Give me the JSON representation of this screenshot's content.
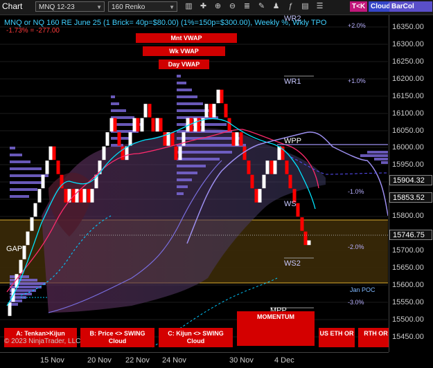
{
  "toolbar": {
    "title": "Chart",
    "instrument": "MNQ 12-23",
    "period": "160 Renko",
    "buttons": {
      "tk": "T<K",
      "cloud": "Cloud",
      "barcol": "BarCol"
    },
    "icons": [
      "bars-icon",
      "crosshair-icon",
      "zoom-in-icon",
      "zoom-out-icon",
      "properties-icon",
      "drawing-tools-icon",
      "strategies-icon",
      "indicators-icon",
      "templates-icon",
      "chart-trader-icon"
    ]
  },
  "header": {
    "line1": "MNQ or NQ 160 RE June 25 (1 Brick= 40p=$80.00) (1%=150p=$300.00), Weekly %, Wkly TPO",
    "line2": "-1.73% = -277.00"
  },
  "vwap_buttons": {
    "month": "Mnt VWAP",
    "week": "Wk VWAP",
    "day": "Day VWAP"
  },
  "price_axis": {
    "labels": [
      "16350.00",
      "16300.00",
      "16250.00",
      "16200.00",
      "16150.00",
      "16100.00",
      "16050.00",
      "16000.00",
      "15950.00",
      "15800.00",
      "15700.00",
      "15650.00",
      "15600.00",
      "15550.00",
      "15500.00",
      "15450.00"
    ],
    "boxes": [
      "15904.32",
      "15853.52",
      "15746.75"
    ]
  },
  "pivots": {
    "wr2": "WR2",
    "wr1": "WR1",
    "wpp": "WPP",
    "ws1": "WS",
    "ws2": "WS2",
    "mpp": "MPP",
    "gap": "GAP",
    "jan_poc": "Jan POC"
  },
  "percents": {
    "p2": "+2.0%",
    "p1": "+1.0%",
    "m1": "-1.0%",
    "m2": "-2.0%",
    "m3": "-3.0%"
  },
  "bottom_buttons": {
    "tenkan": "A: Tenkan>Kijun",
    "price_swing": "B: Price <> SWING Cloud",
    "kijun_swing": "C: Kijun <> SWING Cloud",
    "momentum": "MOMENTUM",
    "us_eth": "US ETH OR",
    "rth": "RTH OR"
  },
  "copyright": "© 2023 NinjaTrader, LLC",
  "time_axis": [
    "15 Nov",
    "20 Nov",
    "22 Nov",
    "24 Nov",
    "30 Nov",
    "4 Dec"
  ],
  "colors": {
    "up": "#ffffff",
    "down": "#ff0000",
    "volume": "#7b68d8",
    "tenkan": "#00e5ff",
    "kijun": "#ff2a6d",
    "cloud": "#6a3b7a",
    "band": "#4a3710",
    "accent": "#d00000"
  },
  "chart_data": {
    "type": "renko",
    "instrument": "MNQ 12-23",
    "brick_size": 40,
    "ylim": [
      15430,
      16380
    ],
    "bricks": [
      {
        "x": 14,
        "o": 15530,
        "c": 15570
      },
      {
        "x": 19,
        "o": 15570,
        "c": 15610
      },
      {
        "x": 24,
        "o": 15610,
        "c": 15650
      },
      {
        "x": 30,
        "o": 15650,
        "c": 15690
      },
      {
        "x": 35,
        "o": 15690,
        "c": 15730
      },
      {
        "x": 40,
        "o": 15730,
        "c": 15770
      },
      {
        "x": 46,
        "o": 15770,
        "c": 15810
      },
      {
        "x": 51,
        "o": 15810,
        "c": 15850
      },
      {
        "x": 57,
        "o": 15850,
        "c": 15890
      },
      {
        "x": 62,
        "o": 15890,
        "c": 15930
      },
      {
        "x": 68,
        "o": 15930,
        "c": 15970
      },
      {
        "x": 73,
        "o": 15970,
        "c": 16010
      },
      {
        "x": 78,
        "o": 16010,
        "c": 15970
      },
      {
        "x": 84,
        "o": 15970,
        "c": 15930
      },
      {
        "x": 89,
        "o": 15930,
        "c": 15890
      },
      {
        "x": 95,
        "o": 15890,
        "c": 15850
      },
      {
        "x": 100,
        "o": 15850,
        "c": 15890
      },
      {
        "x": 106,
        "o": 15890,
        "c": 15850
      },
      {
        "x": 111,
        "o": 15850,
        "c": 15890
      },
      {
        "x": 117,
        "o": 15890,
        "c": 15850
      },
      {
        "x": 122,
        "o": 15850,
        "c": 15890
      },
      {
        "x": 128,
        "o": 15890,
        "c": 15850
      },
      {
        "x": 133,
        "o": 15850,
        "c": 15890
      },
      {
        "x": 139,
        "o": 15890,
        "c": 15930
      },
      {
        "x": 144,
        "o": 15930,
        "c": 15970
      },
      {
        "x": 150,
        "o": 15970,
        "c": 16010
      },
      {
        "x": 155,
        "o": 16010,
        "c": 16050
      },
      {
        "x": 161,
        "o": 16050,
        "c": 16090
      },
      {
        "x": 166,
        "o": 16090,
        "c": 16050
      },
      {
        "x": 172,
        "o": 16050,
        "c": 16010
      },
      {
        "x": 177,
        "o": 16010,
        "c": 15970
      },
      {
        "x": 183,
        "o": 15970,
        "c": 16010
      },
      {
        "x": 188,
        "o": 16010,
        "c": 16050
      },
      {
        "x": 194,
        "o": 16050,
        "c": 16090
      },
      {
        "x": 199,
        "o": 16090,
        "c": 16050
      },
      {
        "x": 205,
        "o": 16050,
        "c": 16090
      },
      {
        "x": 210,
        "o": 16090,
        "c": 16130
      },
      {
        "x": 216,
        "o": 16130,
        "c": 16090
      },
      {
        "x": 221,
        "o": 16090,
        "c": 16050
      },
      {
        "x": 227,
        "o": 16050,
        "c": 16090
      },
      {
        "x": 232,
        "o": 16090,
        "c": 16050
      },
      {
        "x": 238,
        "o": 16050,
        "c": 16010
      },
      {
        "x": 243,
        "o": 16010,
        "c": 16050
      },
      {
        "x": 249,
        "o": 16050,
        "c": 16010
      },
      {
        "x": 254,
        "o": 16010,
        "c": 15970
      },
      {
        "x": 260,
        "o": 15970,
        "c": 16010
      },
      {
        "x": 265,
        "o": 16010,
        "c": 16050
      },
      {
        "x": 271,
        "o": 16050,
        "c": 16090
      },
      {
        "x": 276,
        "o": 16090,
        "c": 16050
      },
      {
        "x": 282,
        "o": 16050,
        "c": 16090
      },
      {
        "x": 287,
        "o": 16090,
        "c": 16050
      },
      {
        "x": 293,
        "o": 16050,
        "c": 16090
      },
      {
        "x": 298,
        "o": 16090,
        "c": 16130
      },
      {
        "x": 304,
        "o": 16130,
        "c": 16090
      },
      {
        "x": 309,
        "o": 16090,
        "c": 16130
      },
      {
        "x": 315,
        "o": 16130,
        "c": 16170
      },
      {
        "x": 320,
        "o": 16170,
        "c": 16130
      },
      {
        "x": 326,
        "o": 16130,
        "c": 16090
      },
      {
        "x": 331,
        "o": 16090,
        "c": 16050
      },
      {
        "x": 337,
        "o": 16050,
        "c": 16010
      },
      {
        "x": 342,
        "o": 16010,
        "c": 16050
      },
      {
        "x": 348,
        "o": 16050,
        "c": 16010
      },
      {
        "x": 353,
        "o": 16010,
        "c": 15970
      },
      {
        "x": 359,
        "o": 15970,
        "c": 15930
      },
      {
        "x": 364,
        "o": 15930,
        "c": 15890
      },
      {
        "x": 370,
        "o": 15890,
        "c": 15850
      },
      {
        "x": 375,
        "o": 15850,
        "c": 15890
      },
      {
        "x": 381,
        "o": 15890,
        "c": 15930
      },
      {
        "x": 386,
        "o": 15930,
        "c": 15970
      },
      {
        "x": 392,
        "o": 15970,
        "c": 15930
      },
      {
        "x": 397,
        "o": 15930,
        "c": 15970
      },
      {
        "x": 403,
        "o": 15970,
        "c": 16010
      },
      {
        "x": 408,
        "o": 16010,
        "c": 15970
      },
      {
        "x": 414,
        "o": 15970,
        "c": 15930
      },
      {
        "x": 419,
        "o": 15930,
        "c": 15890
      },
      {
        "x": 425,
        "o": 15890,
        "c": 15850
      },
      {
        "x": 430,
        "o": 15850,
        "c": 15810
      },
      {
        "x": 436,
        "o": 15810,
        "c": 15770
      },
      {
        "x": 441,
        "o": 15770,
        "c": 15730
      },
      {
        "x": 446,
        "o": 15730,
        "c": 15745
      }
    ]
  }
}
